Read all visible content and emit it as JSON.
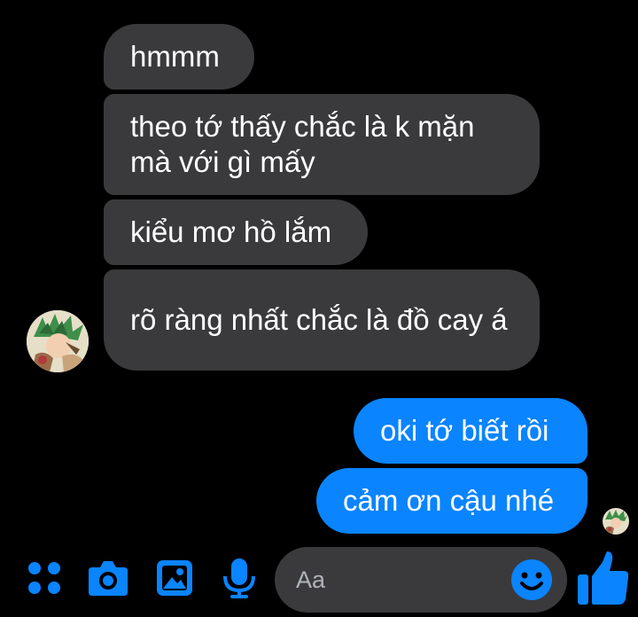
{
  "conversation": {
    "incoming": [
      {
        "text": "hmmm"
      },
      {
        "text": "theo tớ thấy chắc là k mặn mà với gì mấy"
      },
      {
        "text": "kiểu mơ hồ lắm"
      },
      {
        "text": "rõ ràng nhất chắc là đồ cay á"
      }
    ],
    "outgoing": [
      {
        "text": "oki tớ biết rồi"
      },
      {
        "text": "cảm ơn cậu nhé"
      }
    ]
  },
  "composer": {
    "placeholder": "Aa",
    "icons": [
      "menu-dots-icon",
      "camera-icon",
      "gallery-icon",
      "microphone-icon",
      "emoji-icon",
      "thumbs-up-icon"
    ]
  },
  "colors": {
    "background": "#000000",
    "incoming_bubble": "#3a3a3c",
    "outgoing_bubble": "#0a84ff",
    "accent": "#0a84ff",
    "text": "#ffffff",
    "placeholder": "#b0b3b8"
  }
}
